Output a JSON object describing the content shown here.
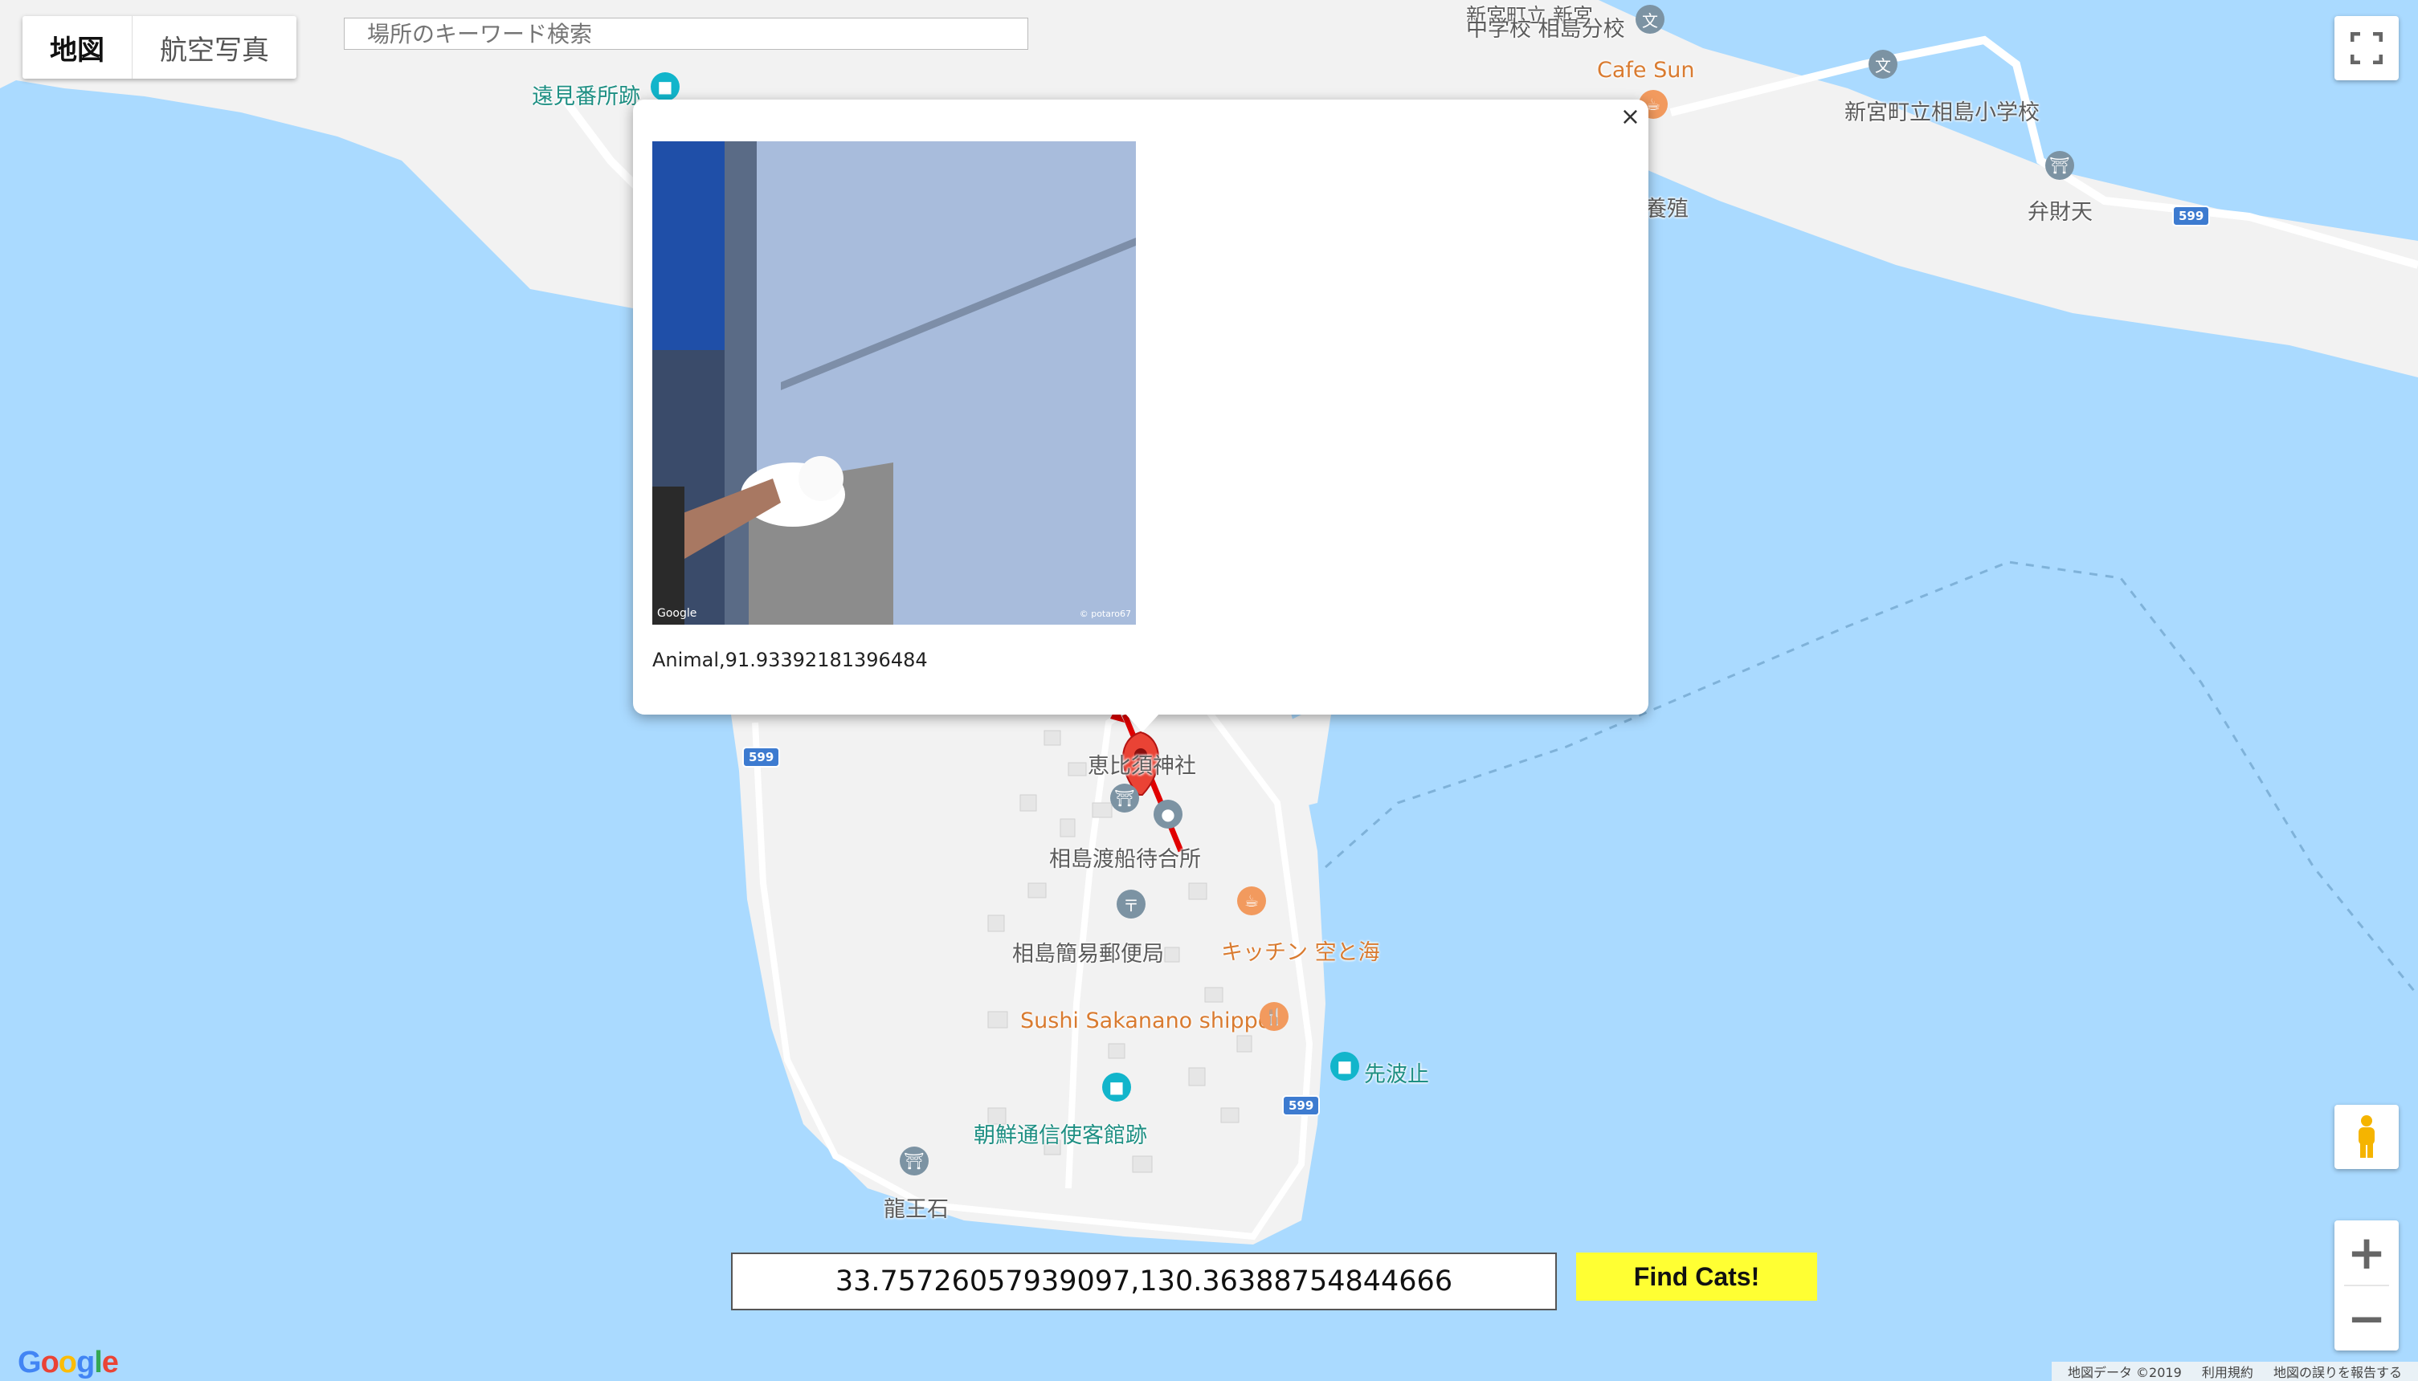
{
  "maptype": {
    "map_label": "地図",
    "satellite_label": "航空写真"
  },
  "search": {
    "placeholder": "場所のキーワード検索"
  },
  "labels": {
    "tomi": "遠見番所跡",
    "school_top": "新宮町立 新宮",
    "school_top2": "中学校 相島分校",
    "cafe": "Cafe Sun",
    "elementary": "新宮町立相島小学校",
    "benzaiten": "弁財天",
    "yoshoku": "養殖",
    "shrine": "恵比須神社",
    "ferry": "相島渡船待合所",
    "post": "相島簡易郵便局",
    "kitchen": "キッチン 空と海",
    "sushi": "Sushi Sakanano shippo",
    "senba": "先波止",
    "chosen": "朝鮮通信使客館跡",
    "ryuo": "龍王石"
  },
  "routes": [
    "599",
    "599",
    "599"
  ],
  "infowindow": {
    "caption": "Animal,91.93392181396484",
    "photo_brand": "Google",
    "photo_author": "© potaro67",
    "close_symbol": "×"
  },
  "coords": {
    "value": "33.75726057939097,130.36388754844666"
  },
  "find_button": {
    "label": "Find Cats!"
  },
  "footer": {
    "google_logo": "Google",
    "map_data": "地図データ ©2019",
    "terms": "利用規約",
    "report": "地図の誤りを報告する"
  },
  "icons": {
    "fullscreen": "fullscreen-icon",
    "pegman": "pegman-icon",
    "zoom_in": "+",
    "zoom_out": "−"
  },
  "colors": {
    "water": "#aadaff",
    "land": "#f2f2f2",
    "marker": "#ea4335",
    "find_button": "#ffff33"
  }
}
